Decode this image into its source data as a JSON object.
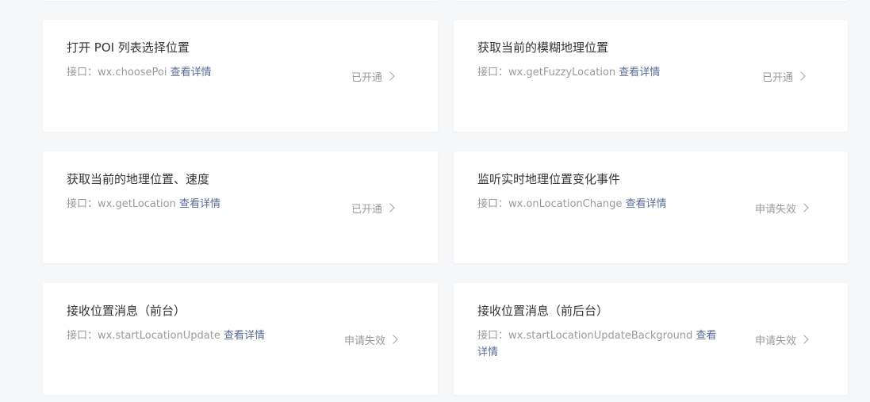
{
  "cards": [
    {
      "title": "打开 POI 列表选择位置",
      "api_prefix": "接口：",
      "api": "wx.choosePoi",
      "detail": "查看详情",
      "status": "已开通"
    },
    {
      "title": "获取当前的模糊地理位置",
      "api_prefix": "接口：",
      "api": "wx.getFuzzyLocation",
      "detail": "查看详情",
      "status": "已开通"
    },
    {
      "title": "获取当前的地理位置、速度",
      "api_prefix": "接口：",
      "api": "wx.getLocation",
      "detail": "查看详情",
      "status": "已开通"
    },
    {
      "title": "监听实时地理位置变化事件",
      "api_prefix": "接口：",
      "api": "wx.onLocationChange",
      "detail": "查看详情",
      "status": "申请失效"
    },
    {
      "title": "接收位置消息（前台）",
      "api_prefix": "接口：",
      "api": "wx.startLocationUpdate",
      "detail": "查看详情",
      "status": "申请失效"
    },
    {
      "title": "接收位置消息（前后台）",
      "api_prefix": "接口：",
      "api": "wx.startLocationUpdateBackground",
      "detail": "查看详情",
      "status": "申请失效"
    }
  ],
  "colors": {
    "background": "#f6f7f9",
    "card": "#ffffff",
    "title": "#353535",
    "muted": "#9a9a9a",
    "link": "#576b95"
  }
}
